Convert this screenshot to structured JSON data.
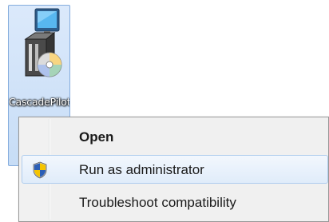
{
  "desktop_icon": {
    "label": "CascadePilot",
    "label_second_line": "..."
  },
  "context_menu": {
    "items": [
      {
        "label": "Open",
        "bold": true,
        "icon": ""
      },
      {
        "label": "Run as administrator",
        "bold": false,
        "icon": "uac-shield-icon",
        "hovered": true
      },
      {
        "label": "Troubleshoot compatibility",
        "bold": false,
        "icon": ""
      }
    ]
  },
  "colors": {
    "selection_fill": "#c7ddf6",
    "selection_border": "#84acdd",
    "menu_background": "#f0f0f0",
    "menu_border": "#979797",
    "hover_border": "#aeccee",
    "shield_blue": "#2b5fb6",
    "shield_yellow": "#f5c400"
  }
}
